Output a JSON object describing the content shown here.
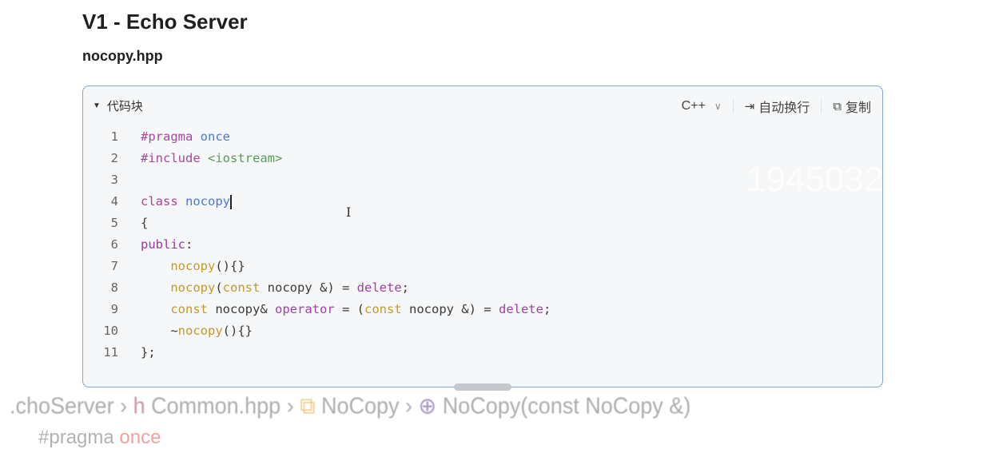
{
  "heading": "V1 - Echo Server",
  "subheading": "nocopy.hpp",
  "code_block": {
    "toggle_label": "代码块",
    "language": "C++",
    "wrap_label": "自动换行",
    "copy_label": "复制",
    "watermark": "1945032",
    "lines": [
      [
        [
          "t-pre",
          "#pragma"
        ],
        [
          "t-plain",
          " "
        ],
        [
          "t-kw2",
          "once"
        ]
      ],
      [
        [
          "t-pre",
          "#include"
        ],
        [
          "t-plain",
          " "
        ],
        [
          "t-str",
          "<iostream>"
        ]
      ],
      [],
      [
        [
          "t-kw",
          "class"
        ],
        [
          "t-plain",
          " "
        ],
        [
          "t-fn",
          "nocopy"
        ]
      ],
      [
        [
          "t-plain",
          "{"
        ]
      ],
      [
        [
          "t-acc",
          "public"
        ],
        [
          "t-plain",
          ":"
        ]
      ],
      [
        [
          "t-plain",
          "    "
        ],
        [
          "t-ctor",
          "nocopy"
        ],
        [
          "t-plain",
          "(){}"
        ]
      ],
      [
        [
          "t-plain",
          "    "
        ],
        [
          "t-ctor",
          "nocopy"
        ],
        [
          "t-plain",
          "("
        ],
        [
          "t-ctor",
          "const"
        ],
        [
          "t-plain",
          " nocopy &) = "
        ],
        [
          "t-del",
          "delete"
        ],
        [
          "t-plain",
          ";"
        ]
      ],
      [
        [
          "t-plain",
          "    "
        ],
        [
          "t-ctor",
          "const"
        ],
        [
          "t-plain",
          " nocopy& "
        ],
        [
          "t-del",
          "operator"
        ],
        [
          "t-plain",
          " = ("
        ],
        [
          "t-ctor",
          "const"
        ],
        [
          "t-plain",
          " nocopy &) = "
        ],
        [
          "t-del",
          "delete"
        ],
        [
          "t-plain",
          ";"
        ]
      ],
      [
        [
          "t-plain",
          "    ~"
        ],
        [
          "t-ctor",
          "nocopy"
        ],
        [
          "t-plain",
          "(){}"
        ]
      ],
      [
        [
          "t-plain",
          "};"
        ]
      ]
    ]
  },
  "background_breadcrumb": {
    "project": ".choServer",
    "file_icon": "h",
    "file": "Common.hpp",
    "class": "NoCopy",
    "member": "NoCopy(const NoCopy &)",
    "next_line_a": "#pragma",
    "next_line_b": "once"
  }
}
